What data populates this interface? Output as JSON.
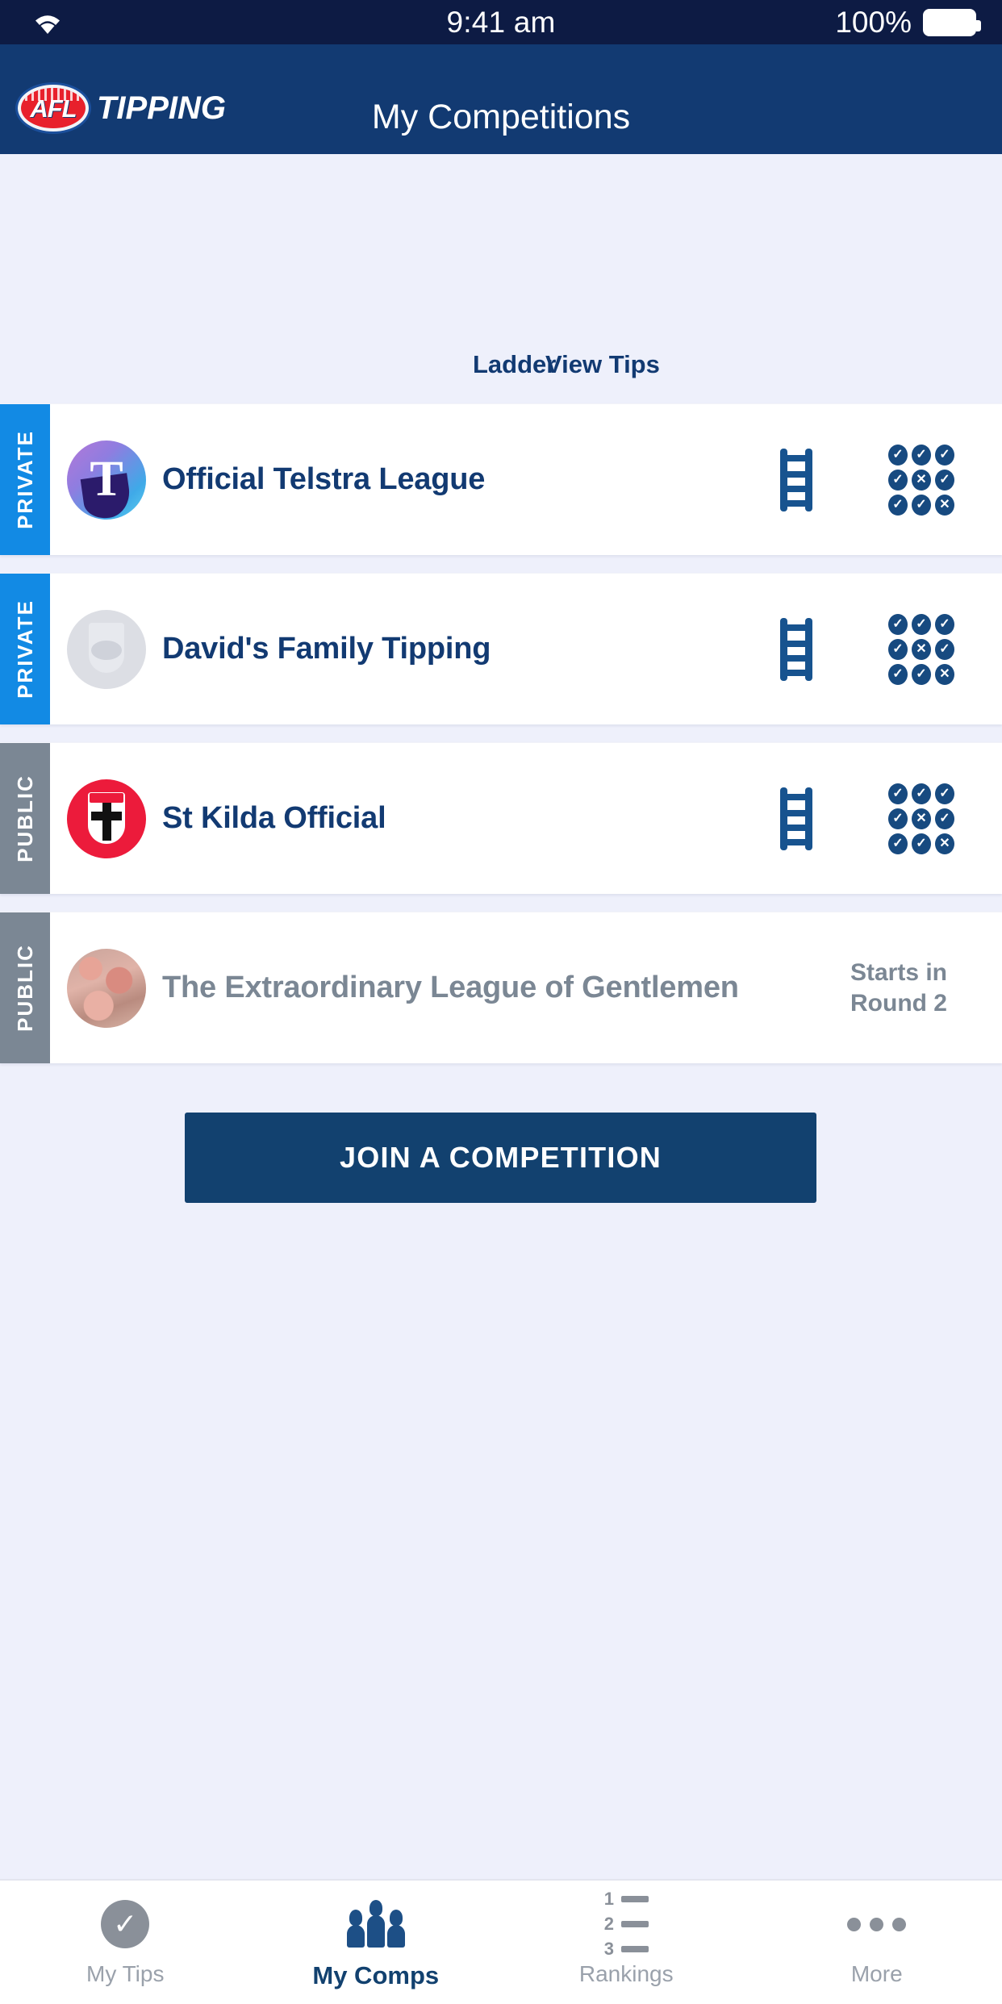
{
  "status_bar": {
    "wifi_icon": "wifi-icon",
    "time": "9:41 am",
    "battery_percent": "100%",
    "battery_icon": "battery-full-icon"
  },
  "header": {
    "brand_mark": "AFL",
    "brand_word": "TIPPING",
    "title": "My Competitions",
    "bg_color": "#123a72"
  },
  "columns": {
    "ladder_label": "Ladder",
    "view_tips_label": "View Tips"
  },
  "competitions": [
    {
      "badge": "PRIVATE",
      "badge_color": "#128ae4",
      "name": "Official Telstra League",
      "avatar": "telstra-logo-icon",
      "enabled": true,
      "ladder_icon": "ladder-icon",
      "tips_icon": "tips-grid-icon",
      "tips_marks": [
        "check",
        "check",
        "check",
        "check",
        "cross",
        "check",
        "check",
        "check",
        "cross"
      ]
    },
    {
      "badge": "PRIVATE",
      "badge_color": "#128ae4",
      "name": "David's Family Tipping",
      "avatar": "placeholder-club-icon",
      "enabled": true,
      "ladder_icon": "ladder-icon",
      "tips_icon": "tips-grid-icon",
      "tips_marks": [
        "check",
        "check",
        "check",
        "check",
        "cross",
        "check",
        "check",
        "check",
        "cross"
      ]
    },
    {
      "badge": "PUBLIC",
      "badge_color": "#7b8794",
      "name": "St Kilda Official",
      "avatar": "st-kilda-logo-icon",
      "enabled": true,
      "ladder_icon": "ladder-icon",
      "tips_icon": "tips-grid-icon",
      "tips_marks": [
        "check",
        "check",
        "check",
        "check",
        "cross",
        "check",
        "check",
        "check",
        "cross"
      ]
    },
    {
      "badge": "PUBLIC",
      "badge_color": "#7b8794",
      "name": "The Extraordinary League of Gentlemen",
      "avatar": "flamingo-photo-avatar",
      "enabled": false,
      "status": "Starts in\nRound 2",
      "status_line1": "Starts in",
      "status_line2": "Round 2"
    }
  ],
  "join_button": {
    "label": "JOIN A COMPETITION",
    "color": "#12416f"
  },
  "tab_bar": {
    "items": [
      {
        "label": "My Tips",
        "icon": "check-circle-icon",
        "active": false
      },
      {
        "label": "My Comps",
        "icon": "people-group-icon",
        "active": true
      },
      {
        "label": "Rankings",
        "icon": "numbered-list-icon",
        "active": false
      },
      {
        "label": "More",
        "icon": "ellipsis-icon",
        "active": false
      }
    ],
    "active_color": "#12416f",
    "inactive_color": "#9aa1ab"
  }
}
